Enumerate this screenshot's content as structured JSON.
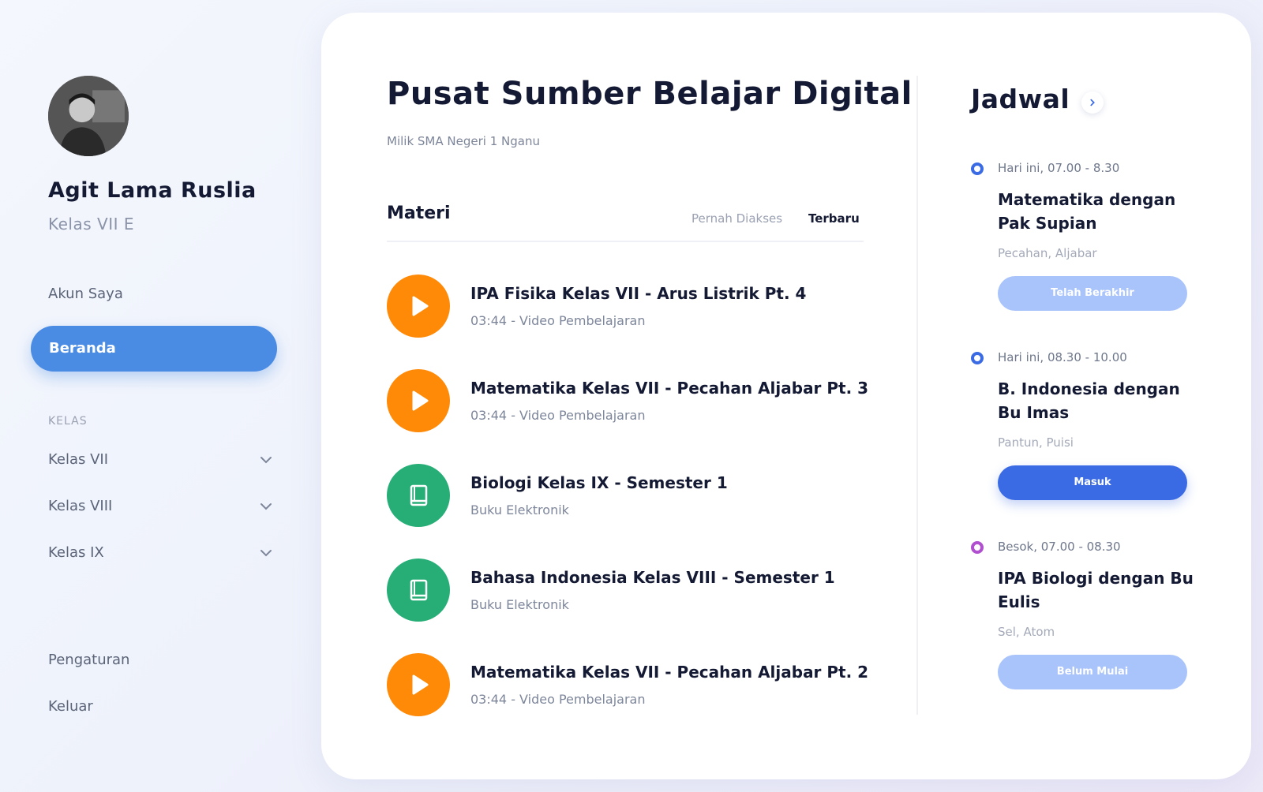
{
  "profile": {
    "name": "Agit Lama Ruslia",
    "class": "Kelas VII E"
  },
  "nav": {
    "account": "Akun Saya",
    "home": "Beranda",
    "section_label": "KELAS",
    "classes": [
      "Kelas VII",
      "Kelas VIII",
      "Kelas IX"
    ],
    "settings": "Pengaturan",
    "logout": "Keluar"
  },
  "main": {
    "title": "Pusat Sumber Belajar Digital",
    "subtitle": "Milik SMA Negeri 1 Nganu",
    "materi_heading": "Materi",
    "filters": [
      "Pernah Diakses",
      "Terbaru"
    ],
    "items": [
      {
        "title": "IPA Fisika Kelas VII - Arus Listrik Pt. 4",
        "meta": "03:44 - Video Pembelajaran",
        "type": "video"
      },
      {
        "title": "Matematika Kelas VII - Pecahan Aljabar Pt. 3",
        "meta": "03:44 - Video Pembelajaran",
        "type": "video"
      },
      {
        "title": "Biologi Kelas IX - Semester 1",
        "meta": "Buku Elektronik",
        "type": "book"
      },
      {
        "title": "Bahasa Indonesia Kelas VIII - Semester 1",
        "meta": "Buku Elektronik",
        "type": "book"
      },
      {
        "title": "Matematika Kelas VII - Pecahan Aljabar Pt. 2",
        "meta": "03:44 - Video Pembelajaran",
        "type": "video"
      }
    ]
  },
  "schedule": {
    "title": "Jadwal",
    "items": [
      {
        "time": "Hari ini, 07.00 - 8.30",
        "title": "Matematika dengan Pak Supian",
        "tags": "Pecahan, Aljabar",
        "button": "Telah Berakhir",
        "state": "ended"
      },
      {
        "time": "Hari ini, 08.30 - 10.00",
        "title": "B. Indonesia dengan Bu Imas",
        "tags": "Pantun, Puisi",
        "button": "Masuk",
        "state": "active"
      },
      {
        "time": "Besok, 07.00 - 08.30",
        "title": "IPA Biologi dengan Bu Eulis",
        "tags": "Sel, Atom",
        "button": "Belum Mulai",
        "state": "upcoming"
      }
    ]
  },
  "colors": {
    "accent": "#4a8be4",
    "primary_button": "#3a6be4",
    "muted_button": "#a9c3fb",
    "video_icon": "#ff8a08",
    "book_icon": "#27ae76",
    "dot_today": "#3a6be4",
    "dot_tomorrow": "#b04fcf"
  },
  "icons": {
    "video": "play-icon",
    "book": "book-icon",
    "chevron": "chevron-down-icon",
    "jadwal_arrow": "chevron-right-icon"
  }
}
